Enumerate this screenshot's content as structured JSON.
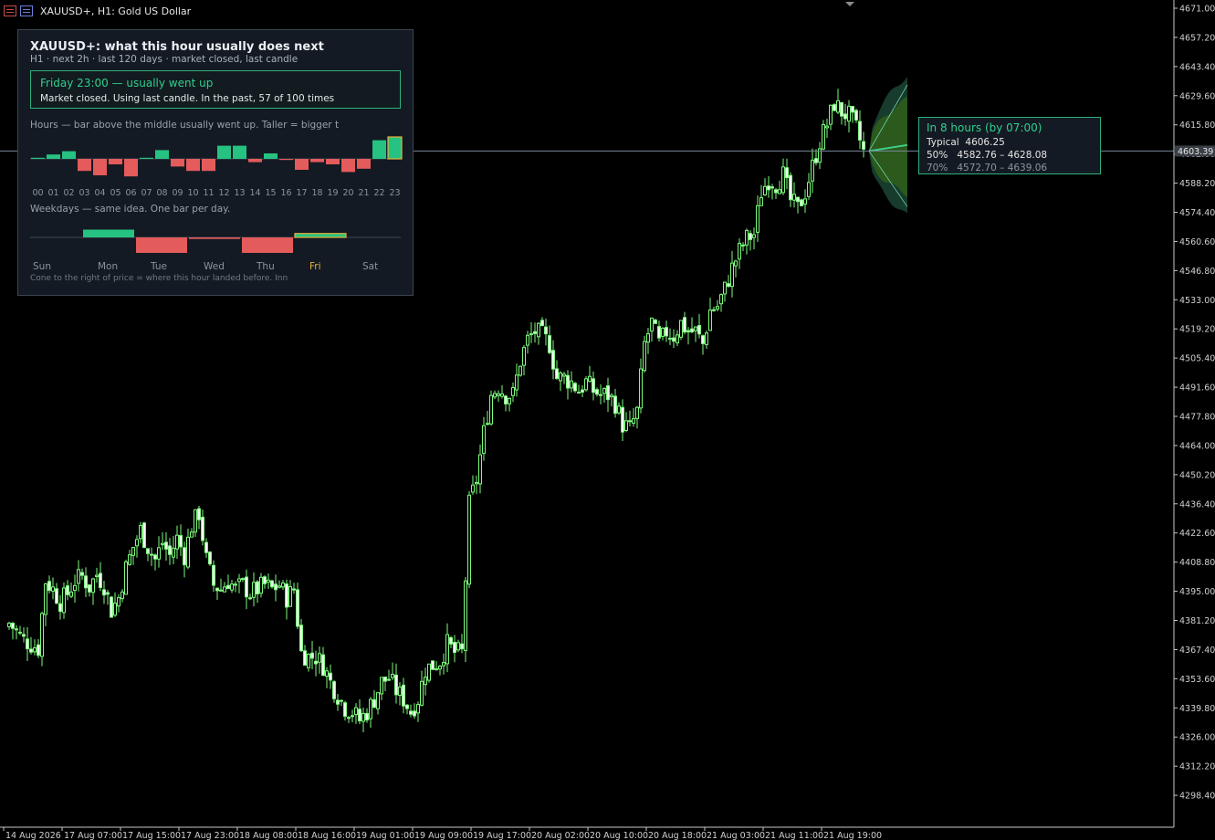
{
  "window": {
    "title": "XAUUSD+, H1:  Gold US Dollar"
  },
  "panel": {
    "title": "XAUUSD+: what this hour usually does next",
    "subtitle": "H1  ·  next 2h  ·  last 120 days  ·  market closed, last candle",
    "highlight_heading": "Friday 23:00 — usually went up",
    "highlight_line": "Market closed. Using last candle.  In the past, 57 of 100 times",
    "hours_caption": "Hours — bar above the middle usually went up. Taller = bigger t",
    "weekdays_caption": "Weekdays — same idea. One bar per day.",
    "footer": "Cone to the right of price = where this hour landed before. Inn",
    "hours": {
      "labels": [
        "00",
        "01",
        "02",
        "03",
        "04",
        "05",
        "06",
        "07",
        "08",
        "09",
        "10",
        "11",
        "12",
        "13",
        "14",
        "15",
        "16",
        "17",
        "18",
        "19",
        "20",
        "21",
        "22",
        "23"
      ],
      "values": [
        0.05,
        0.2,
        0.35,
        -0.55,
        -0.75,
        -0.25,
        -0.8,
        0.05,
        0.4,
        -0.35,
        -0.55,
        -0.55,
        0.6,
        0.6,
        -0.15,
        0.25,
        -0.05,
        -0.5,
        -0.15,
        -0.25,
        -0.6,
        -0.45,
        0.85,
        1.0
      ],
      "highlight": "23"
    },
    "weekdays": {
      "labels": [
        "Sun",
        "Mon",
        "Tue",
        "Wed",
        "Thu",
        "Fri",
        "Sat"
      ],
      "values": [
        0,
        0.5,
        -1.0,
        -0.1,
        -1.0,
        0.25,
        0
      ],
      "highlight": "Fri"
    },
    "colors": {
      "up": "#26c281",
      "down": "#e45b5b",
      "highlight": "#e8b23a"
    }
  },
  "forecast": {
    "heading": "In 8 hours  (by 07:00)",
    "typical_label": "Typical",
    "typical_value": "4606.25",
    "band50_label": "50%",
    "band50_value": "4582.76 – 4628.08",
    "band70_label": "70%",
    "band70_value": "4572.70 – 4639.06"
  },
  "chart_data": {
    "type": "candlestick",
    "symbol": "XAUUSD+",
    "timeframe": "H1",
    "ylim": [
      4284.6,
      4671.0
    ],
    "y_ticks": [
      4671.0,
      4657.2,
      4643.4,
      4629.6,
      4615.8,
      4602.0,
      4588.2,
      4574.4,
      4560.6,
      4546.8,
      4533.0,
      4519.2,
      4505.4,
      4491.6,
      4477.8,
      4464.0,
      4450.2,
      4436.4,
      4422.6,
      4408.8,
      4395.0,
      4381.2,
      4367.4,
      4353.6,
      4339.8,
      4326.0,
      4312.2,
      4298.4
    ],
    "y_tick_labels": [
      "4671.00",
      "4657.20",
      "4643.40",
      "4629.60",
      "4615.80",
      "4602.00",
      "4588.20",
      "4574.40",
      "4560.60",
      "4546.80",
      "4533.00",
      "4519.20",
      "4505.40",
      "4491.60",
      "4477.80",
      "4464.00",
      "4450.20",
      "4436.40",
      "4422.60",
      "4408.80",
      "4395.00",
      "4381.20",
      "4367.40",
      "4353.60",
      "4339.80",
      "4326.00",
      "4312.20",
      "4298.40"
    ],
    "current_price": 4603.39,
    "current_price_label": "4603.39",
    "x_labels": [
      "14 Aug 2026",
      "17 Aug 07:00",
      "17 Aug 15:00",
      "17 Aug 23:00",
      "18 Aug 08:00",
      "18 Aug 16:00",
      "19 Aug 01:00",
      "19 Aug 09:00",
      "19 Aug 17:00",
      "20 Aug 02:00",
      "20 Aug 10:00",
      "20 Aug 18:00",
      "21 Aug 03:00",
      "21 Aug 11:00",
      "21 Aug 19:00"
    ],
    "x_label_bars": [
      0,
      16,
      32,
      48,
      64,
      80,
      96,
      112,
      128,
      144,
      160,
      176,
      192,
      208,
      224
    ],
    "bar_spacing_px": 4,
    "close_path": [
      [
        0,
        4380
      ],
      [
        4,
        4372
      ],
      [
        8,
        4368
      ],
      [
        10,
        4400
      ],
      [
        12,
        4396
      ],
      [
        14,
        4390
      ],
      [
        16,
        4394
      ],
      [
        18,
        4400
      ],
      [
        20,
        4402
      ],
      [
        22,
        4397
      ],
      [
        24,
        4403
      ],
      [
        26,
        4398
      ],
      [
        28,
        4386
      ],
      [
        30,
        4392
      ],
      [
        32,
        4406
      ],
      [
        34,
        4416
      ],
      [
        36,
        4424
      ],
      [
        38,
        4416
      ],
      [
        40,
        4410
      ],
      [
        42,
        4418
      ],
      [
        44,
        4412
      ],
      [
        46,
        4420
      ],
      [
        48,
        4412
      ],
      [
        50,
        4426
      ],
      [
        52,
        4432
      ],
      [
        54,
        4410
      ],
      [
        56,
        4398
      ],
      [
        58,
        4396
      ],
      [
        60,
        4400
      ],
      [
        62,
        4396
      ],
      [
        64,
        4398
      ],
      [
        66,
        4394
      ],
      [
        68,
        4396
      ],
      [
        70,
        4398
      ],
      [
        72,
        4396
      ],
      [
        74,
        4398
      ],
      [
        76,
        4392
      ],
      [
        78,
        4396
      ],
      [
        80,
        4366
      ],
      [
        82,
        4364
      ],
      [
        84,
        4364
      ],
      [
        86,
        4360
      ],
      [
        88,
        4352
      ],
      [
        90,
        4346
      ],
      [
        92,
        4340
      ],
      [
        94,
        4338
      ],
      [
        96,
        4334
      ],
      [
        98,
        4338
      ],
      [
        100,
        4344
      ],
      [
        102,
        4352
      ],
      [
        104,
        4354
      ],
      [
        106,
        4348
      ],
      [
        108,
        4344
      ],
      [
        110,
        4338
      ],
      [
        112,
        4344
      ],
      [
        114,
        4358
      ],
      [
        116,
        4360
      ],
      [
        118,
        4362
      ],
      [
        120,
        4370
      ],
      [
        122,
        4366
      ],
      [
        124,
        4366
      ],
      [
        126,
        4436
      ],
      [
        128,
        4448
      ],
      [
        130,
        4470
      ],
      [
        132,
        4488
      ],
      [
        134,
        4492
      ],
      [
        136,
        4488
      ],
      [
        138,
        4488
      ],
      [
        140,
        4504
      ],
      [
        142,
        4514
      ],
      [
        144,
        4518
      ],
      [
        146,
        4516
      ],
      [
        148,
        4512
      ],
      [
        150,
        4496
      ],
      [
        152,
        4496
      ],
      [
        154,
        4494
      ],
      [
        156,
        4490
      ],
      [
        158,
        4494
      ],
      [
        160,
        4490
      ],
      [
        162,
        4488
      ],
      [
        164,
        4488
      ],
      [
        166,
        4484
      ],
      [
        168,
        4474
      ],
      [
        170,
        4472
      ],
      [
        172,
        4480
      ],
      [
        174,
        4512
      ],
      [
        176,
        4522
      ],
      [
        178,
        4512
      ],
      [
        180,
        4518
      ],
      [
        182,
        4516
      ],
      [
        184,
        4522
      ],
      [
        186,
        4518
      ],
      [
        188,
        4518
      ],
      [
        190,
        4512
      ],
      [
        192,
        4528
      ],
      [
        194,
        4530
      ],
      [
        196,
        4538
      ],
      [
        198,
        4548
      ],
      [
        200,
        4556
      ],
      [
        202,
        4562
      ],
      [
        204,
        4564
      ],
      [
        206,
        4584
      ],
      [
        208,
        4590
      ],
      [
        210,
        4588
      ],
      [
        212,
        4592
      ],
      [
        214,
        4580
      ],
      [
        216,
        4576
      ],
      [
        218,
        4584
      ],
      [
        220,
        4596
      ],
      [
        222,
        4608
      ],
      [
        224,
        4616
      ],
      [
        226,
        4626
      ],
      [
        228,
        4622
      ],
      [
        230,
        4620
      ],
      [
        232,
        4614
      ],
      [
        234,
        4603
      ]
    ],
    "forecast_cone": {
      "horizon": "8 hours",
      "typical": 4606.25,
      "band50": [
        4582.76,
        4628.08
      ],
      "band70": [
        4572.7,
        4639.06
      ]
    },
    "colors": {
      "candle": "#7CFC7C",
      "axis": "#c8c8c8",
      "price_line": "#778899",
      "cone_inner": "#2b5a1c",
      "cone_outer": "#173b2c"
    }
  }
}
